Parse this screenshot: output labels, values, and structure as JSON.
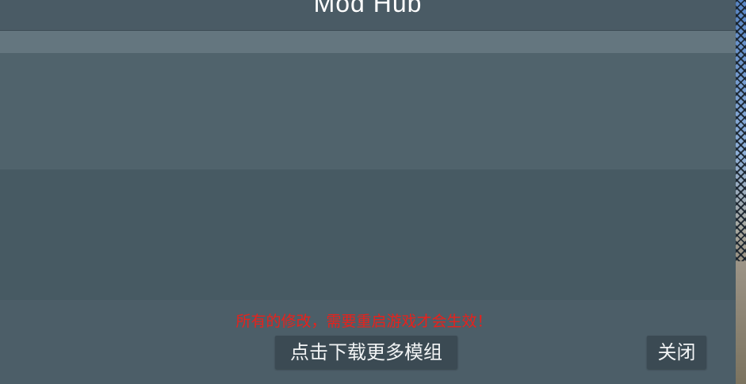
{
  "window": {
    "title": "Mod Hub"
  },
  "footer": {
    "notice": "所有的修改，需要重启游戏才会生效！",
    "more_mods_label": "点击下载更多模组",
    "close_label": "关闭"
  },
  "colors": {
    "notice": "#e8211b",
    "panel": "#4b5d67",
    "button": "#3b4a53"
  }
}
